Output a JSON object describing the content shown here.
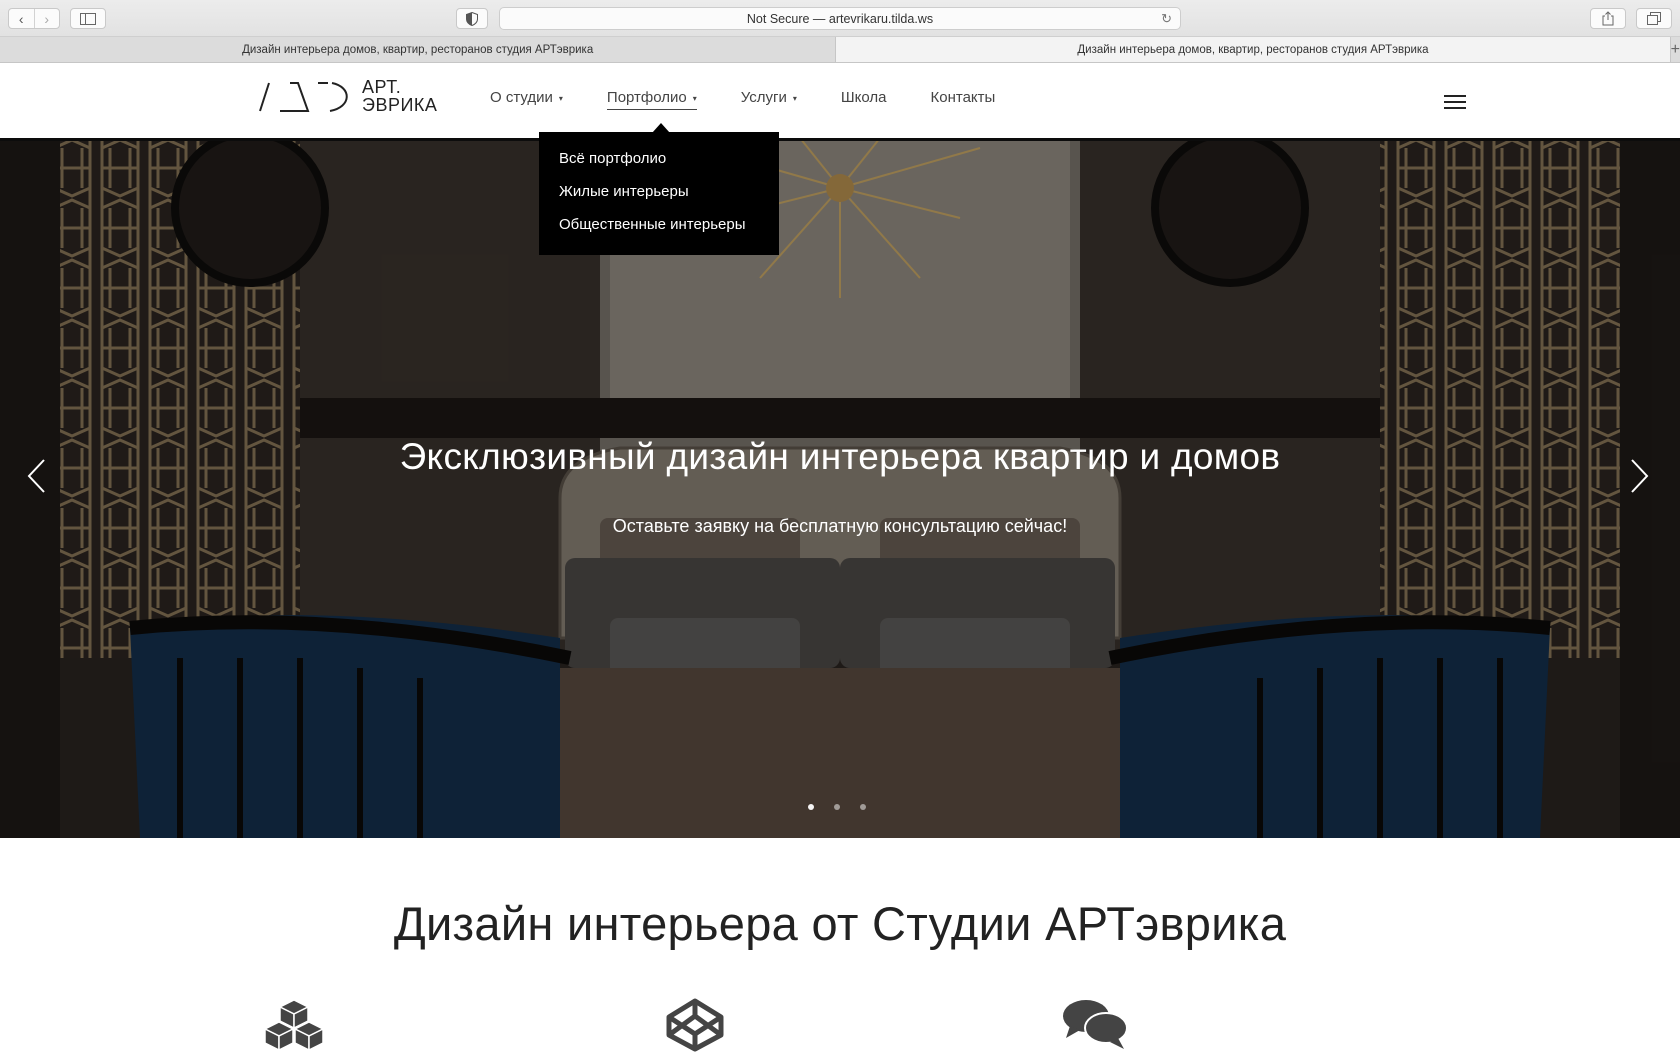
{
  "browser": {
    "address": "Not Secure — artevrikaru.tilda.ws",
    "tabs": [
      {
        "title": "Дизайн интерьера домов, квартир, ресторанов студия АРТэврика"
      },
      {
        "title": "Дизайн интерьера домов, квартир, ресторанов студия АРТэврика"
      }
    ],
    "icons": [
      "back-icon",
      "forward-icon",
      "sidebar-icon",
      "shield-icon",
      "reload-icon",
      "share-icon",
      "tabs-overview-icon",
      "new-tab-icon"
    ]
  },
  "header": {
    "logo_line1": "АРТ.",
    "logo_line2": "ЭВРИКА",
    "menu": [
      {
        "label": "О студии",
        "has_caret": true
      },
      {
        "label": "Портфолио",
        "has_caret": true,
        "active": true
      },
      {
        "label": "Услуги",
        "has_caret": true
      },
      {
        "label": "Школа",
        "has_caret": false
      },
      {
        "label": "Контакты",
        "has_caret": false
      }
    ],
    "caret": "▾"
  },
  "dropdown": {
    "items": [
      "Всё портфолио",
      "Жилые интерьеры",
      "Общественные интерьеры"
    ]
  },
  "hero": {
    "title": "Эксклюзивный дизайн интерьера квартир и домов",
    "subtitle": "Оставьте заявку на бесплатную консультацию сейчас!",
    "prev_arrow": "‹",
    "next_arrow": "›",
    "slides_count": 3,
    "active_slide": 1
  },
  "section": {
    "title": "Дизайн интерьера от Студии АРТэврика",
    "icons": [
      "cubes-icon",
      "codepen-icon",
      "chat-bubbles-icon"
    ]
  },
  "colors": {
    "dropdown_bg": "#000000",
    "text_dark": "#222222",
    "hero_overlay": "rgba(0,0,0,0.28)"
  }
}
